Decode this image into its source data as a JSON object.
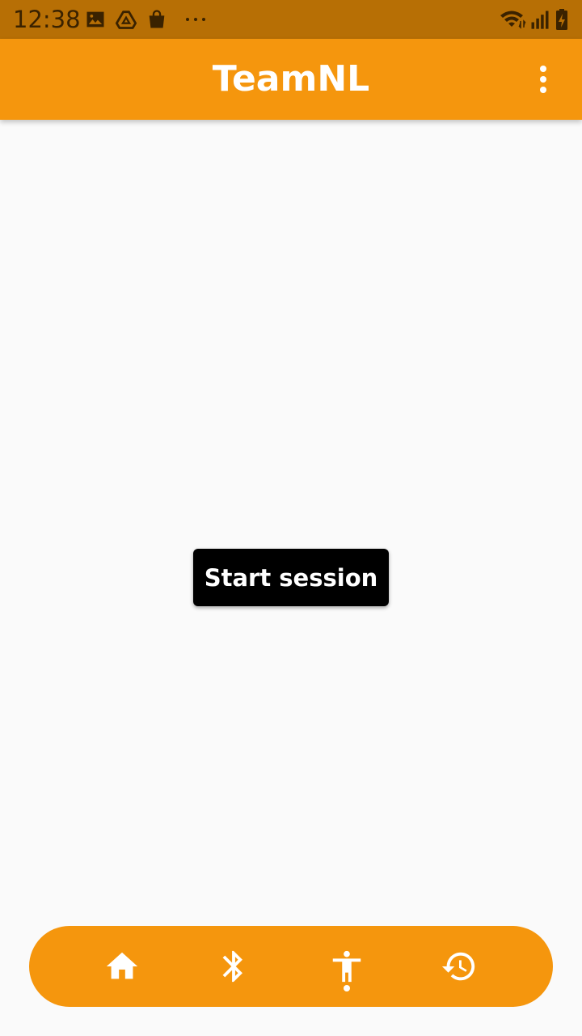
{
  "status_bar": {
    "time": "12:38",
    "left_icons": [
      "gallery-icon",
      "drive-icon",
      "shopping-bag-icon",
      "more-notifications-icon"
    ],
    "right_icons": [
      "wifi-icon",
      "signal-icon",
      "battery-charging-icon"
    ]
  },
  "app_bar": {
    "title": "TeamNL",
    "menu_icon": "more-vert-icon"
  },
  "main": {
    "start_button_label": "Start session"
  },
  "bottom_nav": {
    "items": [
      {
        "icon": "home-icon",
        "selected": false
      },
      {
        "icon": "bluetooth-icon",
        "selected": false
      },
      {
        "icon": "accessibility-icon",
        "selected": true
      },
      {
        "icon": "history-icon",
        "selected": false
      }
    ]
  },
  "colors": {
    "status_bar": "#b76f05",
    "accent": "#f5960d",
    "background": "#fafafa",
    "button": "#000000",
    "on_accent": "#ffffff"
  }
}
